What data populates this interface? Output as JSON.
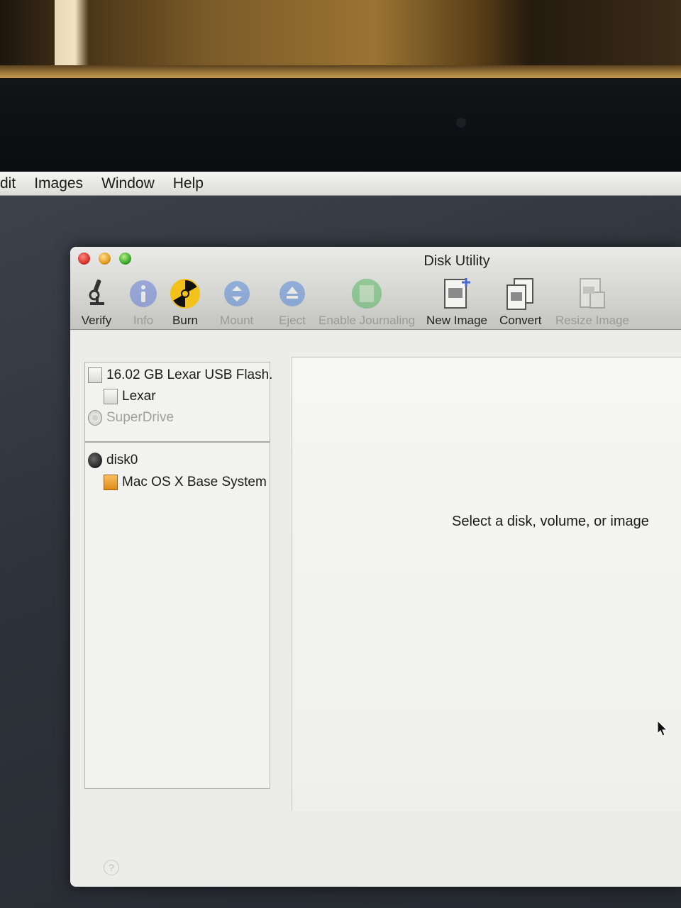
{
  "menubar": {
    "items": [
      "dit",
      "Images",
      "Window",
      "Help"
    ]
  },
  "window": {
    "title": "Disk Utility"
  },
  "toolbar": {
    "tools": [
      {
        "label": "Verify",
        "icon": "microscope-icon",
        "enabled": true
      },
      {
        "label": "Info",
        "icon": "info-icon",
        "enabled": false
      },
      {
        "label": "Burn",
        "icon": "burn-icon",
        "enabled": true
      },
      {
        "label": "Mount",
        "icon": "mount-icon",
        "enabled": false
      },
      {
        "label": "Eject",
        "icon": "eject-icon",
        "enabled": false
      },
      {
        "label": "Enable Journaling",
        "icon": "journaling-icon",
        "enabled": false
      },
      {
        "label": "New Image",
        "icon": "new-image-icon",
        "enabled": true
      },
      {
        "label": "Convert",
        "icon": "convert-icon",
        "enabled": true
      },
      {
        "label": "Resize Image",
        "icon": "resize-image-icon",
        "enabled": false
      }
    ]
  },
  "sidebar": {
    "items": [
      {
        "label": "16.02 GB Lexar USB Flash...",
        "icon": "usb-drive-icon",
        "level": 0
      },
      {
        "label": "Lexar",
        "icon": "volume-icon",
        "level": 1
      },
      {
        "label": "SuperDrive",
        "icon": "optical-drive-icon",
        "level": 0,
        "dimmed": true
      },
      {
        "label": "disk0",
        "icon": "hard-disk-icon",
        "level": 0
      },
      {
        "label": "Mac OS X Base System",
        "icon": "mac-volume-icon",
        "level": 1
      }
    ]
  },
  "detail": {
    "message": "Select a disk, volume, or image"
  },
  "footer": {
    "help_label": "?"
  },
  "colors": {
    "close": "#d8332a",
    "minimize": "#e09a20",
    "zoom": "#3ca82a",
    "desktop": "#2e333b"
  }
}
